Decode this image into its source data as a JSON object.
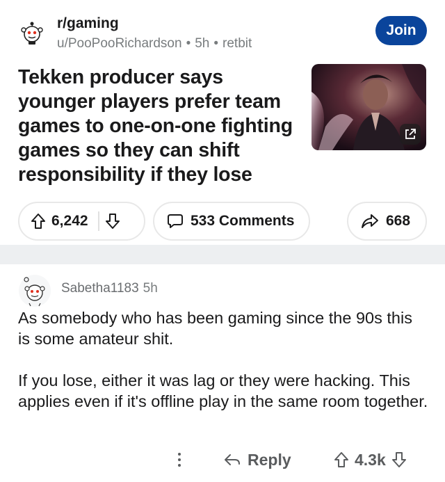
{
  "post": {
    "subreddit": "r/gaming",
    "author": "u/PooPooRichardson",
    "age": "5h",
    "flair": "retbit",
    "join_label": "Join",
    "title": "Tekken producer says younger players prefer team games to one-on-one fighting games so they can shift responsibility if they lose",
    "upvotes": "6,242",
    "comments_label": "533 Comments",
    "shares": "668"
  },
  "comment": {
    "author": "Sabetha1183",
    "age": "5h",
    "paragraphs": [
      "As somebody who has been gaming since the 90s this is some amateur shit.",
      "If you lose, either it was lag or they were hacking. This applies even if it's offline play in the same room together."
    ],
    "reply_label": "Reply",
    "score": "4.3k"
  },
  "colors": {
    "join_button": "#0a449b",
    "divider_band": "#edeff1",
    "meta_text": "#787c7e"
  },
  "icons": {
    "subreddit_avatar": "reddit-snoo-icon",
    "thumbnail_overlay": "external-link-icon",
    "upvote": "arrow-up-icon",
    "downvote": "arrow-down-icon",
    "comments": "speech-bubble-icon",
    "share": "share-arrow-icon",
    "more": "vertical-ellipsis-icon",
    "reply": "reply-arrow-icon"
  }
}
